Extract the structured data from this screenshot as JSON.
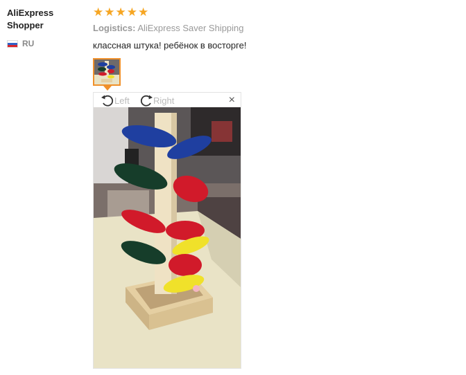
{
  "reviewer": {
    "name": "AliExpress Shopper",
    "country": "RU",
    "flag_colors": [
      "#ffffff",
      "#2f62c8",
      "#d9262b"
    ]
  },
  "review": {
    "rating": 5,
    "star_glyph": "★",
    "star_color": "#f6a623",
    "logistics_label": "Logistics:",
    "logistics_value": "AliExpress Saver Shipping",
    "text": "классная штука! ребёнок в восторге!"
  },
  "viewer": {
    "rotate_left_label": "Left",
    "rotate_right_label": "Right",
    "close_symbol": "×",
    "accent_color": "#f0902a",
    "photo_subject": "wooden marble-run tree toy"
  }
}
